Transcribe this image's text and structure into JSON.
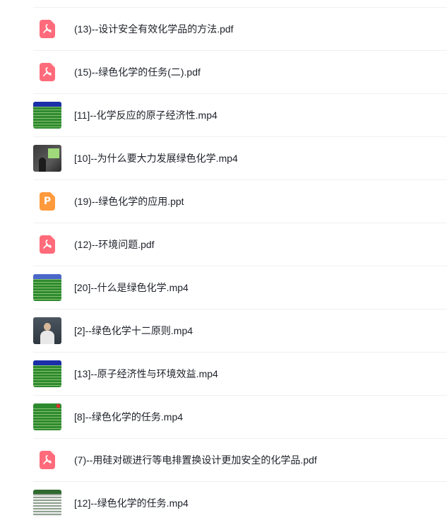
{
  "files": [
    {
      "name": "(13)--设计安全有效化学品的方法.pdf",
      "icon": "pdf-icon"
    },
    {
      "name": "(15)--绿色化学的任务(二).pdf",
      "icon": "pdf-icon"
    },
    {
      "name": "[11]--化学反应的原子经济性.mp4",
      "icon": "video-thumbnail"
    },
    {
      "name": "[10]--为什么要大力发展绿色化学.mp4",
      "icon": "video-thumbnail"
    },
    {
      "name": "(19)--绿色化学的应用.ppt",
      "icon": "ppt-icon"
    },
    {
      "name": "(12)--环境问题.pdf",
      "icon": "pdf-icon"
    },
    {
      "name": "[20]--什么是绿色化学.mp4",
      "icon": "video-thumbnail"
    },
    {
      "name": "[2]--绿色化学十二原则.mp4",
      "icon": "video-thumbnail"
    },
    {
      "name": "[13]--原子经济性与环境效益.mp4",
      "icon": "video-thumbnail"
    },
    {
      "name": "[8]--绿色化学的任务.mp4",
      "icon": "video-thumbnail"
    },
    {
      "name": "(7)--用硅对碳进行等电排置换设计更加安全的化学品.pdf",
      "icon": "pdf-icon"
    },
    {
      "name": "[12]--绿色化学的任务.mp4",
      "icon": "video-thumbnail"
    }
  ],
  "colors": {
    "pdf": "#ff6b7a",
    "ppt": "#ff9a3c",
    "text": "#1d2129",
    "divider": "#f0f0f0"
  }
}
